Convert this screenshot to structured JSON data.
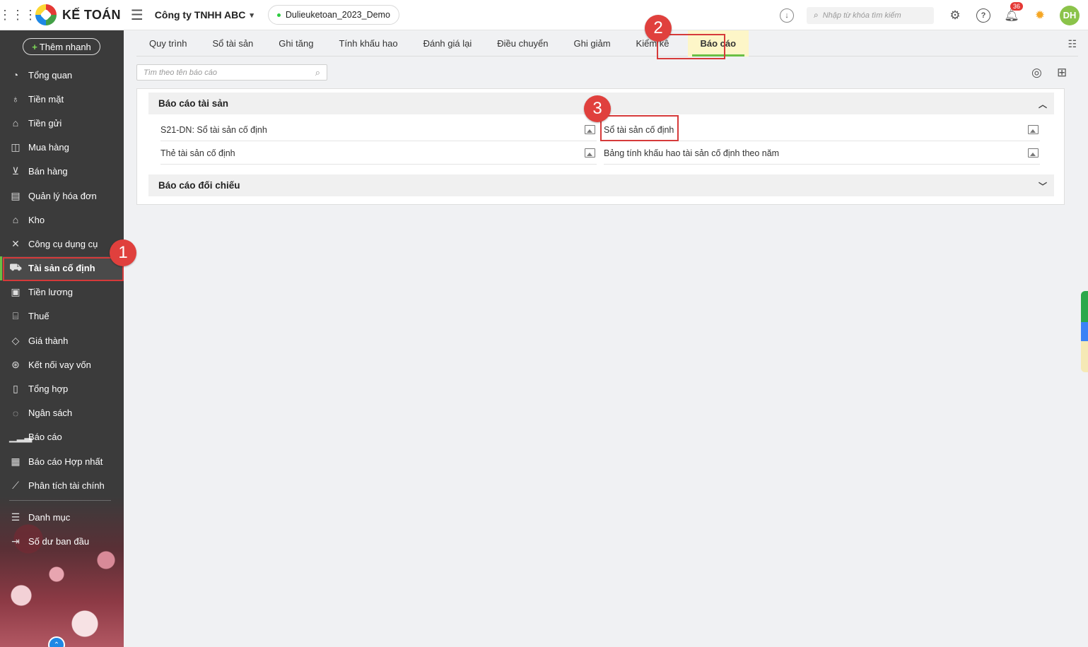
{
  "topbar": {
    "app_name": "KẾ TOÁN",
    "company": "Công ty TNHH ABC",
    "database": "Dulieuketoan_2023_Demo",
    "search_placeholder": "Nhập từ khóa tìm kiếm",
    "notification_count": "36",
    "avatar_initials": "DH"
  },
  "sidebar": {
    "quick_add": "Thêm nhanh",
    "items": [
      {
        "label": "Tổng quan",
        "icon": "dashboard-icon"
      },
      {
        "label": "Tiền mặt",
        "icon": "money-bag-icon"
      },
      {
        "label": "Tiền gửi",
        "icon": "bank-icon"
      },
      {
        "label": "Mua hàng",
        "icon": "shopping-bag-icon"
      },
      {
        "label": "Bán hàng",
        "icon": "cart-icon"
      },
      {
        "label": "Quản lý hóa đơn",
        "icon": "invoice-icon"
      },
      {
        "label": "Kho",
        "icon": "warehouse-icon"
      },
      {
        "label": "Công cụ dụng cụ",
        "icon": "tools-icon"
      },
      {
        "label": "Tài sản cố định",
        "icon": "car-icon"
      },
      {
        "label": "Tiền lương",
        "icon": "salary-icon"
      },
      {
        "label": "Thuế",
        "icon": "tax-building-icon"
      },
      {
        "label": "Giá thành",
        "icon": "price-tag-icon"
      },
      {
        "label": "Kết nối vay vốn",
        "icon": "loan-link-icon"
      },
      {
        "label": "Tổng hợp",
        "icon": "ledger-icon"
      },
      {
        "label": "Ngân sách",
        "icon": "budget-icon"
      },
      {
        "label": "Báo cáo",
        "icon": "bar-chart-icon"
      },
      {
        "label": "Báo cáo Hợp nhất",
        "icon": "consolidated-report-icon"
      },
      {
        "label": "Phân tích tài chính",
        "icon": "line-chart-icon"
      },
      {
        "label": "Danh mục",
        "icon": "list-icon"
      },
      {
        "label": "Số dư ban đầu",
        "icon": "opening-balance-icon"
      }
    ],
    "active_index": 8
  },
  "tabs": [
    "Quy trình",
    "Sổ tài sản",
    "Ghi tăng",
    "Tính khấu hao",
    "Đánh giá lại",
    "Điều chuyển",
    "Ghi giảm",
    "Kiểm kê",
    "Báo cáo"
  ],
  "active_tab_index": 8,
  "report_search_placeholder": "Tìm theo tên báo cáo",
  "groups": [
    {
      "title": "Báo cáo tài sản",
      "expanded": true,
      "reports": [
        "S21-DN: Sổ tài sản cố định",
        "Sổ tài sản cố định",
        "Thẻ tài sản cố định",
        "Bảng tính khấu hao tài sản cố định theo năm"
      ]
    },
    {
      "title": "Báo cáo đối chiếu",
      "expanded": false,
      "reports": []
    }
  ],
  "markers": [
    "1",
    "2",
    "3"
  ],
  "colors": {
    "sidebar_bg": "#3b3b3b",
    "accent_green": "#6abf45",
    "highlight_red": "#d63a3a",
    "active_tab_bg": "#fdf6c8"
  }
}
